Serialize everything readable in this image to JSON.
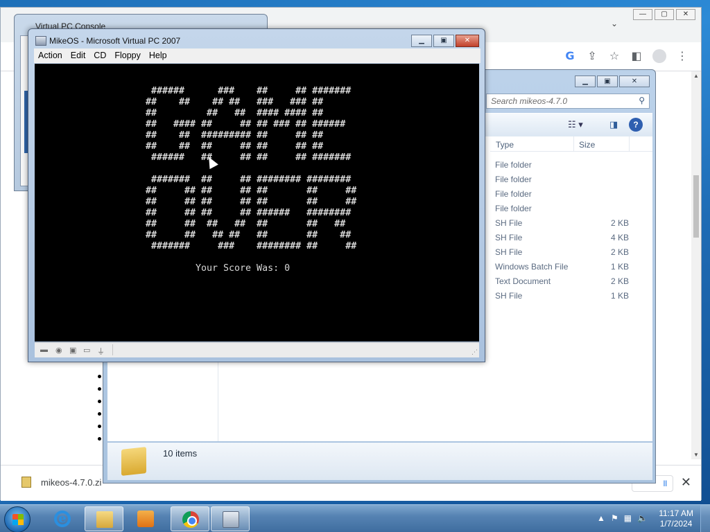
{
  "chrome": {
    "tab_chevron": "⌄",
    "download_filename": "mikeos-4.7.0.zi",
    "show_all_label": "ll",
    "window_controls": {
      "minimize": "—",
      "maximize": "▢",
      "close": "✕"
    }
  },
  "vpc_console": {
    "title": "Virtual PC Console"
  },
  "explorer": {
    "search_placeholder": "Search mikeos-4.7.0",
    "columns": {
      "type": "Type",
      "size": "Size"
    },
    "files": [
      {
        "type": "File folder",
        "size": ""
      },
      {
        "type": "File folder",
        "size": ""
      },
      {
        "type": "File folder",
        "size": ""
      },
      {
        "type": "File folder",
        "size": ""
      },
      {
        "type": "SH File",
        "size": "2 KB"
      },
      {
        "type": "SH File",
        "size": "4 KB"
      },
      {
        "type": "SH File",
        "size": "2 KB"
      },
      {
        "type": "Windows Batch File",
        "size": "1 KB"
      },
      {
        "type": "Text Document",
        "size": "2 KB"
      },
      {
        "type": "SH File",
        "size": "1 KB"
      }
    ],
    "item_count": "10 items"
  },
  "vpc_window": {
    "title": "MikeOS - Microsoft Virtual PC 2007",
    "menu": [
      "Action",
      "Edit",
      "CD",
      "Floppy",
      "Help"
    ],
    "screen": {
      "ascii_game_over": " ######      ###    ##     ## #######\n##    ##    ## ##   ###   ### ##\n##         ##   ##  #### #### ##\n##   #### ##     ## ## ### ## ######\n##    ##  ######### ##     ## ##\n##    ##  ##     ## ##     ## ##\n ######   ##     ## ##     ## #######\n\n #######  ##     ## ######## ########\n##     ## ##     ## ##       ##     ##\n##     ## ##     ## ##       ##     ##\n##     ## ##     ## ######   ########\n##     ##  ##   ##  ##       ##   ##\n##     ##   ## ##   ##       ##    ##\n #######     ###    ######## ##     ##",
      "score_text": "Your Score Was: 0"
    }
  },
  "taskbar": {
    "clock_time": "11:17 AM",
    "clock_date": "1/7/2024",
    "apps": [
      "internet-explorer",
      "windows-explorer",
      "media-player",
      "google-chrome",
      "virtual-pc"
    ]
  },
  "colors": {
    "desktop_blue": "#1f6cb5",
    "vpc_screen_bg": "#000000",
    "vpc_screen_text": "#d8d8d8"
  }
}
